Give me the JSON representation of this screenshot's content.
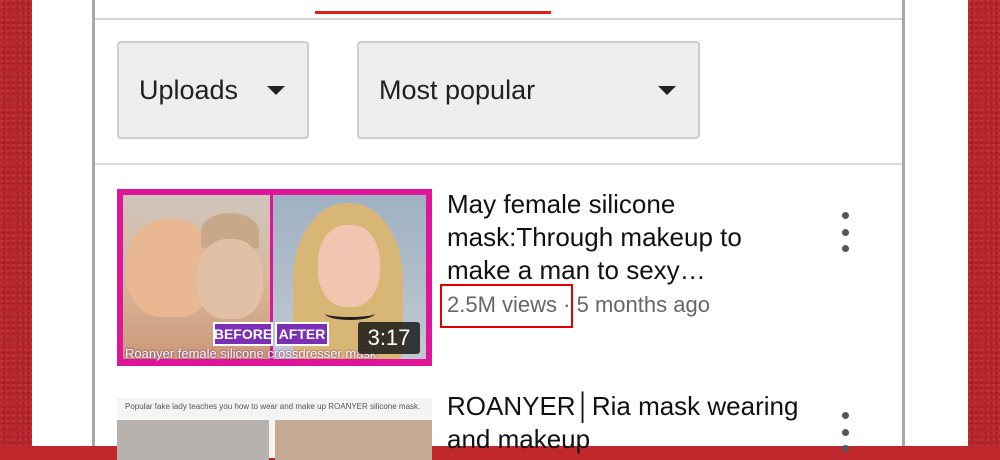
{
  "filters": {
    "uploads_label": "Uploads",
    "sort_label": "Most popular"
  },
  "video1": {
    "title": "May female silicone mask:Through makeup to make a man to sexy…",
    "views": "2.5M views",
    "separator": "·",
    "age": "5 months ago",
    "duration": "3:17",
    "thumb_tag_before": "BEFORE",
    "thumb_tag_after": "AFTER",
    "thumb_caption": "Roanyer female silicone crossdresser mask"
  },
  "video2": {
    "title": "ROANYER│Ria mask wearing and makeup",
    "thumb_text": "Popular fake lady teaches you how to wear and make up ROANYER silicone mask."
  },
  "colors": {
    "accent": "#e21f1f",
    "highlight_box": "#e00000",
    "background_red": "#c0282d",
    "thumb_border": "#e0159a"
  },
  "icons": {
    "dropdown": "caret-down-icon",
    "more": "kebab-menu-icon"
  }
}
